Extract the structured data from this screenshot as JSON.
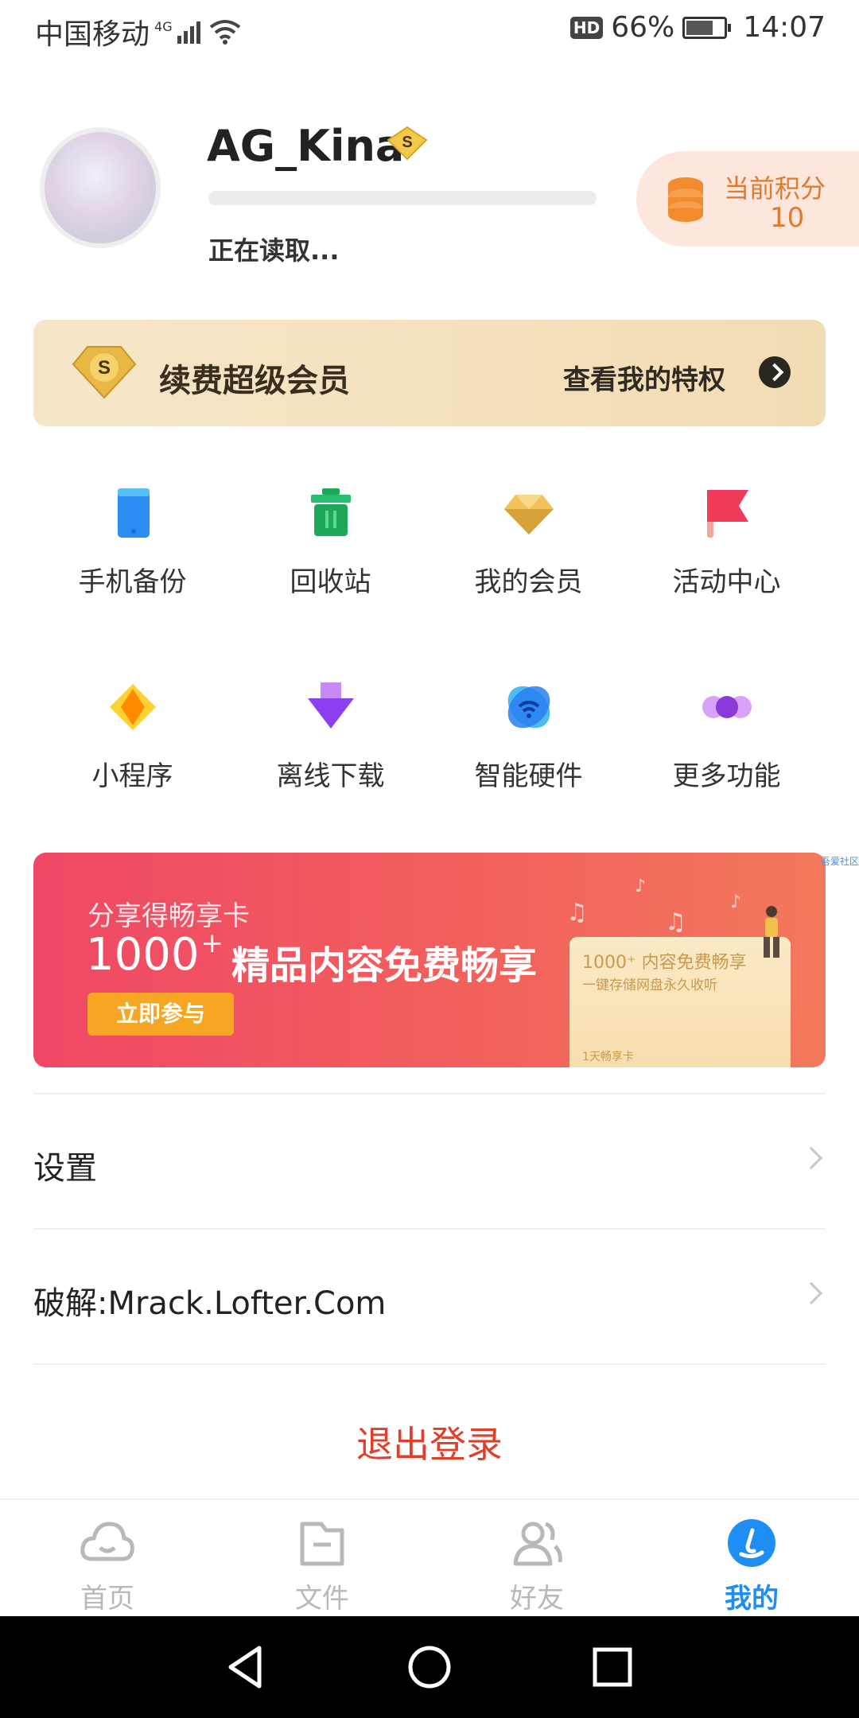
{
  "status_bar": {
    "carrier": "中国移动",
    "network": "4G",
    "hd_badge": "HD",
    "battery_percent": "66%",
    "battery_level": 0.66,
    "time": "14:07"
  },
  "profile": {
    "username": "AG_Kina",
    "vip_badge_letter": "S",
    "loading_text": "正在读取...",
    "points_label": "当前积分",
    "points_value": "10"
  },
  "vip_banner": {
    "badge_letter": "S",
    "title": "续费超级会员",
    "link": "查看我的特权"
  },
  "grid": {
    "row1": [
      {
        "label": "手机备份",
        "icon": "phone-backup-icon"
      },
      {
        "label": "回收站",
        "icon": "recycle-bin-icon"
      },
      {
        "label": "我的会员",
        "icon": "diamond-icon"
      },
      {
        "label": "活动中心",
        "icon": "flag-icon"
      }
    ],
    "row2": [
      {
        "label": "小程序",
        "icon": "mini-program-icon"
      },
      {
        "label": "离线下载",
        "icon": "offline-download-icon"
      },
      {
        "label": "智能硬件",
        "icon": "smart-hardware-icon"
      },
      {
        "label": "更多功能",
        "icon": "more-dots-icon"
      }
    ]
  },
  "promo": {
    "subtitle": "分享得畅享卡",
    "number": "1000",
    "plus": "+",
    "headline": "精品内容免费畅享",
    "button": "立即参与",
    "card_line1": "1000⁺ 内容免费畅享",
    "card_line2": "一键存储网盘永久收听",
    "card_footer": "1天畅享卡",
    "corner_text": "吾爱社区"
  },
  "settings": {
    "settings_label": "设置",
    "crack_label": "破解:Mrack.Lofter.Com",
    "logout_label": "退出登录"
  },
  "tabbar": {
    "tabs": [
      {
        "label": "首页",
        "icon": "cloud-icon"
      },
      {
        "label": "文件",
        "icon": "folder-icon"
      },
      {
        "label": "好友",
        "icon": "friends-icon"
      },
      {
        "label": "我的",
        "icon": "profile-icon"
      }
    ],
    "active_color": "#1e8ef4",
    "inactive_color": "#b8b8b8"
  },
  "colors": {
    "accent_blue": "#1e8ef4",
    "logout_red": "#e0402a",
    "points_orange": "#e07a2e",
    "promo_red": "#f04866"
  }
}
